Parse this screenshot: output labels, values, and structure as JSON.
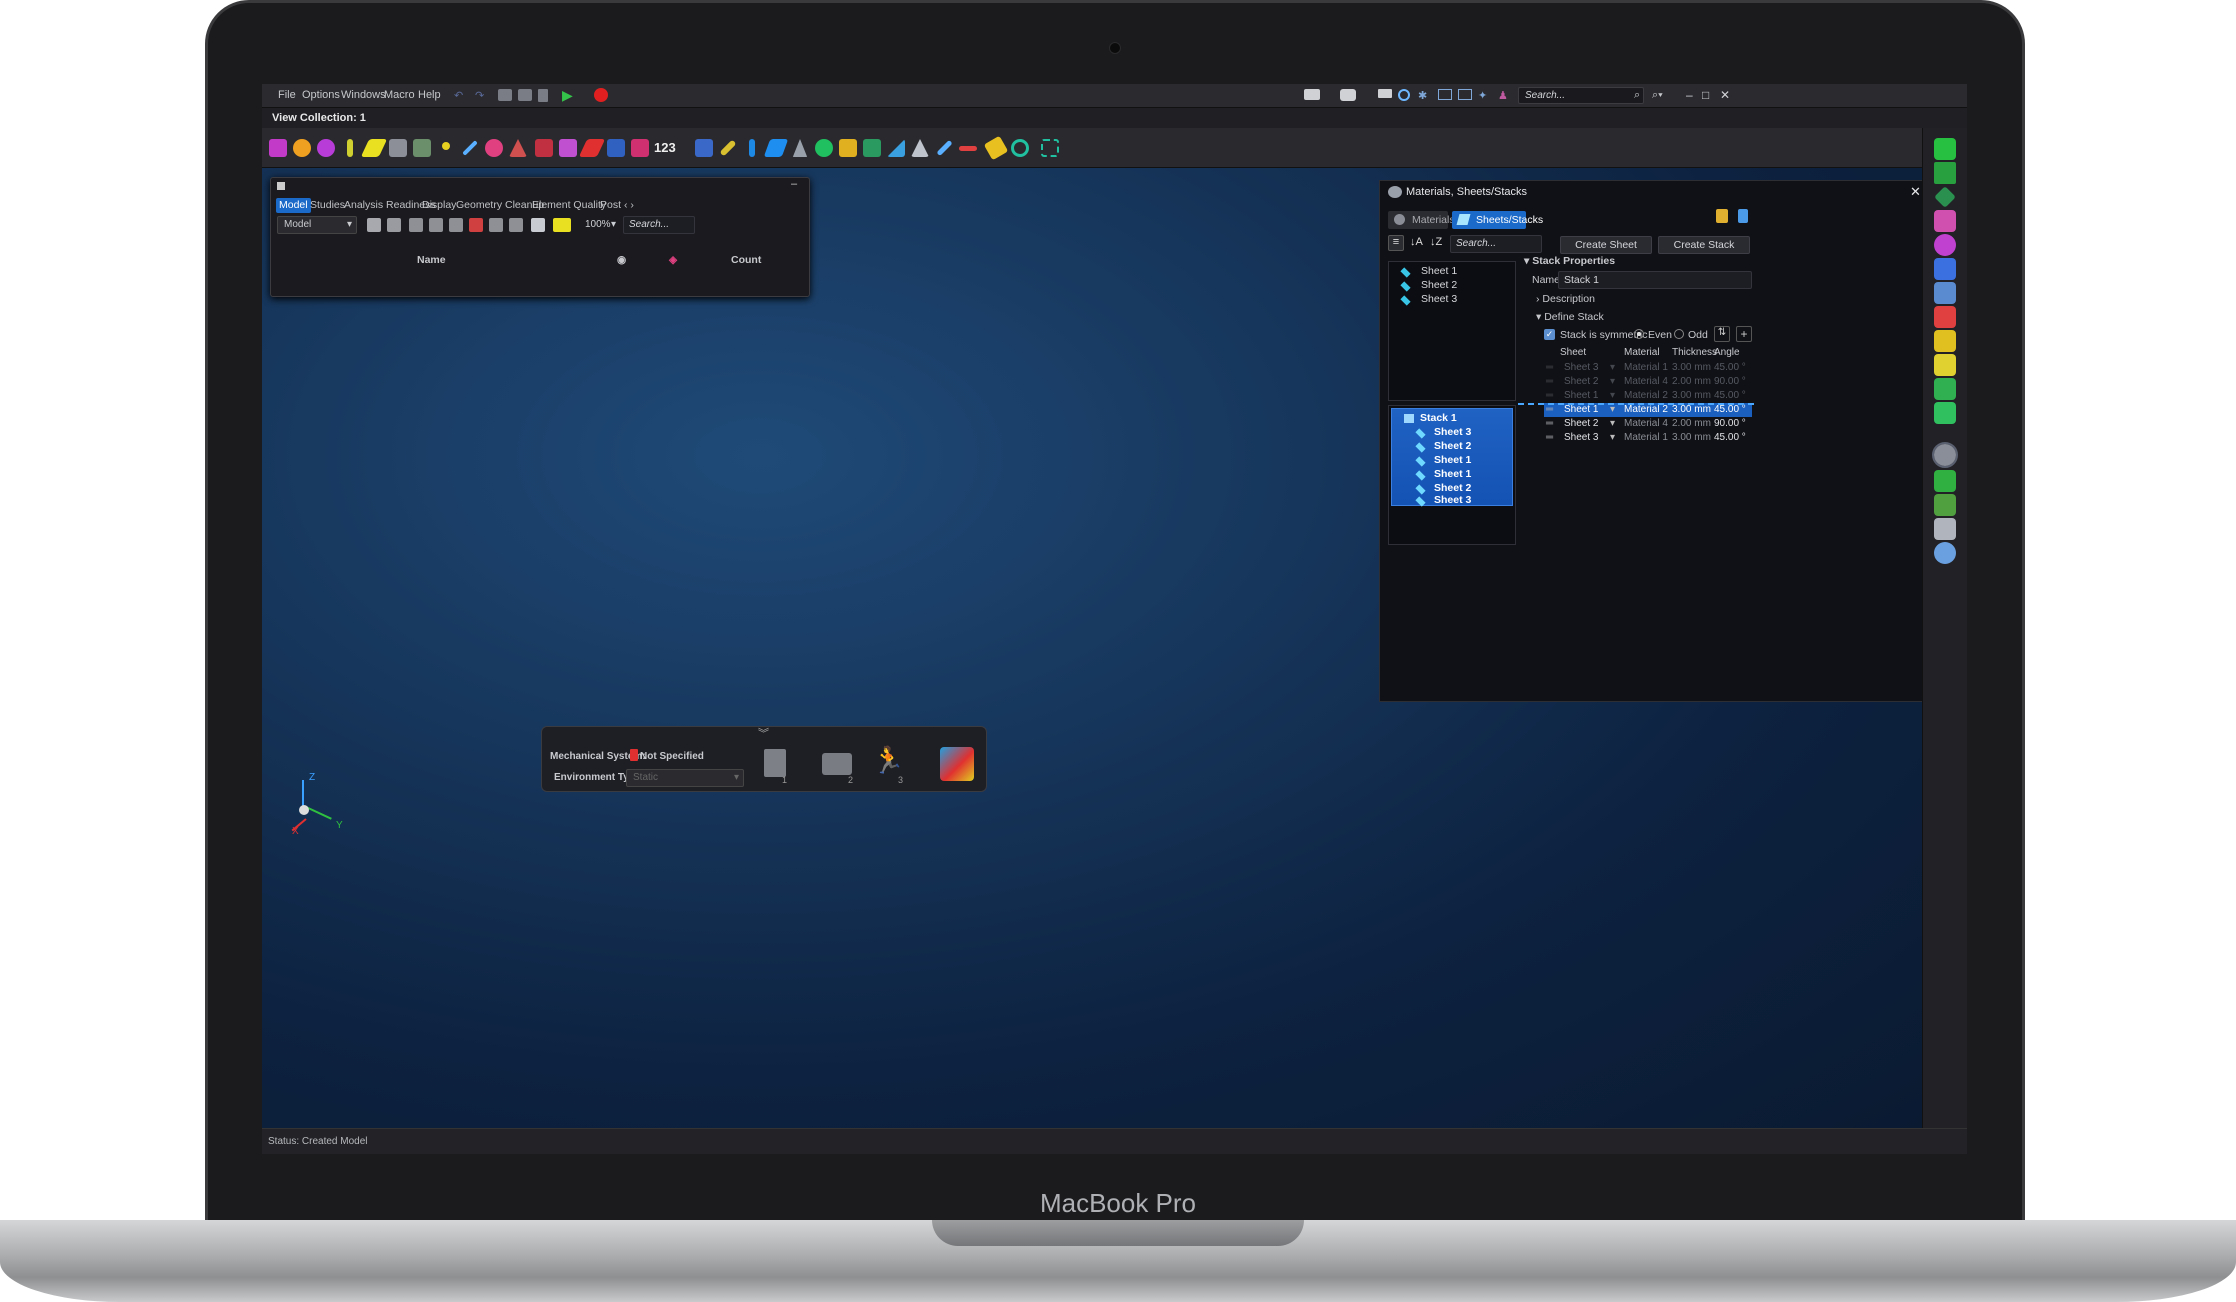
{
  "device": {
    "brand": "MacBook Pro"
  },
  "menu": {
    "items": [
      "File",
      "Options",
      "Windows",
      "Macro",
      "Help"
    ],
    "search_placeholder": "Search..."
  },
  "view_collection": {
    "title": "View Collection: 1"
  },
  "toolbar": {
    "number_label": "123"
  },
  "model_browser": {
    "tabs": [
      "Model",
      "Studies",
      "Analysis Readiness",
      "Display",
      "Geometry Cleanup",
      "Element Quality",
      "Post"
    ],
    "active_tab": "Model",
    "view_select": "Model",
    "zoom": "100%",
    "search_placeholder": "Search...",
    "columns": {
      "name": "Name",
      "count": "Count"
    }
  },
  "materials_panel": {
    "title": "Materials, Sheets/Stacks",
    "tabs": {
      "materials": "Materials",
      "sheets_stacks": "Sheets/Stacks"
    },
    "search_placeholder": "Search...",
    "buttons": {
      "create_sheet": "Create Sheet",
      "create_stack": "Create Stack"
    },
    "sheets": [
      "Sheet 1",
      "Sheet 2",
      "Sheet 3"
    ],
    "stack": {
      "name": "Stack 1",
      "items": [
        "Sheet 3",
        "Sheet 2",
        "Sheet 1",
        "Sheet 1",
        "Sheet 2",
        "Sheet 3"
      ]
    },
    "properties": {
      "section": "Stack Properties",
      "name_label": "Name",
      "name_value": "Stack 1",
      "description": "Description",
      "define_stack": "Define Stack",
      "symmetric_label": "Stack is symmetric",
      "symmetric_checked": true,
      "even_label": "Even",
      "odd_label": "Odd",
      "parity": "Even"
    },
    "table": {
      "headers": [
        "Sheet",
        "Material",
        "Thickness",
        "Angle"
      ],
      "rows": [
        {
          "sheet": "Sheet 3",
          "material": "Material 1",
          "thickness": "3.00 mm",
          "angle": "45.00 °",
          "mirrored": true,
          "selected": false
        },
        {
          "sheet": "Sheet 2",
          "material": "Material 4",
          "thickness": "2.00 mm",
          "angle": "90.00 °",
          "mirrored": true,
          "selected": false
        },
        {
          "sheet": "Sheet 1",
          "material": "Material 2",
          "thickness": "3.00 mm",
          "angle": "45.00 °",
          "mirrored": true,
          "selected": false
        },
        {
          "sheet": "Sheet 1",
          "material": "Material 2",
          "thickness": "3.00 mm",
          "angle": "45.00 °",
          "mirrored": false,
          "selected": true
        },
        {
          "sheet": "Sheet 2",
          "material": "Material 4",
          "thickness": "2.00 mm",
          "angle": "90.00 °",
          "mirrored": false,
          "selected": false
        },
        {
          "sheet": "Sheet 3",
          "material": "Material 1",
          "thickness": "3.00 mm",
          "angle": "45.00 °",
          "mirrored": false,
          "selected": false
        }
      ]
    }
  },
  "bottom_panel": {
    "mechanical_system_label": "Mechanical System:",
    "mechanical_system_value": "Not Specified",
    "environment_type_label": "Environment Type:",
    "environment_type_value": "Static",
    "step_numbers": [
      "1",
      "2",
      "3"
    ]
  },
  "axis": {
    "x": "X",
    "y": "Y",
    "z": "Z"
  },
  "status": {
    "text": "Status:  Created Model"
  },
  "colors": {
    "accent": "#1b6ac9",
    "record": "#e02020",
    "play": "#35c24a",
    "viewport": "#16355a"
  }
}
